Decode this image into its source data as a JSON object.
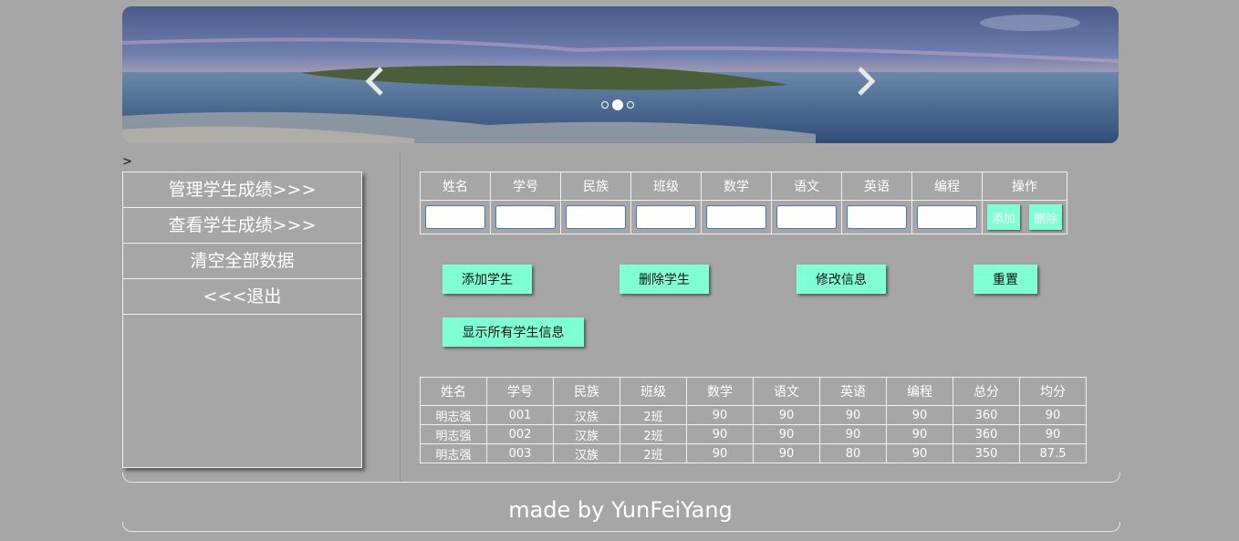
{
  "banner": {
    "dots_total": 3,
    "active_dot": 2
  },
  "stray_text": ">",
  "sidebar": {
    "items": [
      {
        "label": "管理学生成绩>>>"
      },
      {
        "label": "查看学生成绩>>>"
      },
      {
        "label": "清空全部数据"
      },
      {
        "label": "<<<退出"
      }
    ]
  },
  "form_table": {
    "headers": [
      "姓名",
      "学号",
      "民族",
      "班级",
      "数学",
      "语文",
      "英语",
      "编程",
      "操作"
    ],
    "add_label": "添加",
    "delete_label": "删除"
  },
  "actions": {
    "add_student": "添加学生",
    "delete_student": "删除学生",
    "modify_info": "修改信息",
    "reset": "重置",
    "show_all": "显示所有学生信息"
  },
  "results_table": {
    "headers": [
      "姓名",
      "学号",
      "民族",
      "班级",
      "数学",
      "语文",
      "英语",
      "编程",
      "总分",
      "均分"
    ],
    "rows": [
      [
        "明志强",
        "001",
        "汉族",
        "2班",
        "90",
        "90",
        "90",
        "90",
        "360",
        "90"
      ],
      [
        "明志强",
        "002",
        "汉族",
        "2班",
        "90",
        "90",
        "90",
        "90",
        "360",
        "90"
      ],
      [
        "明志强",
        "003",
        "汉族",
        "2班",
        "90",
        "90",
        "80",
        "90",
        "350",
        "87.5"
      ]
    ]
  },
  "footer": {
    "text": "made by YunFeiYang"
  },
  "colors": {
    "background": "#a6a6a6",
    "button": "#7fffd4",
    "border": "#f0f0f0"
  }
}
